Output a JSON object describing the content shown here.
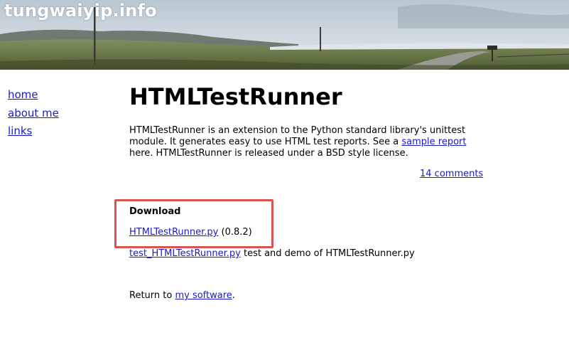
{
  "site": {
    "title": "tungwaiyip.info"
  },
  "nav": {
    "items": [
      {
        "label": "home"
      },
      {
        "label": "about me"
      },
      {
        "label": "links"
      }
    ]
  },
  "page": {
    "title": "HTMLTestRunner",
    "description_part1": "HTMLTestRunner is an extension to the Python standard library's unittest module. It generates easy to use HTML test reports. See a ",
    "description_link": "sample report",
    "description_part2": " here. HTMLTestRunner is released under a BSD style license.",
    "comments_link": "14 comments"
  },
  "download": {
    "heading": "Download",
    "file_link": "HTMLTestRunner.py",
    "version": " (0.8.2)",
    "test_link": "test_HTMLTestRunner.py",
    "test_desc": " test and demo of HTMLTestRunner.py"
  },
  "footer": {
    "return_prefix": "Return to ",
    "return_link": "my software",
    "return_suffix": "."
  },
  "colors": {
    "link": "#1a1acc",
    "highlight": "#d9534f"
  }
}
